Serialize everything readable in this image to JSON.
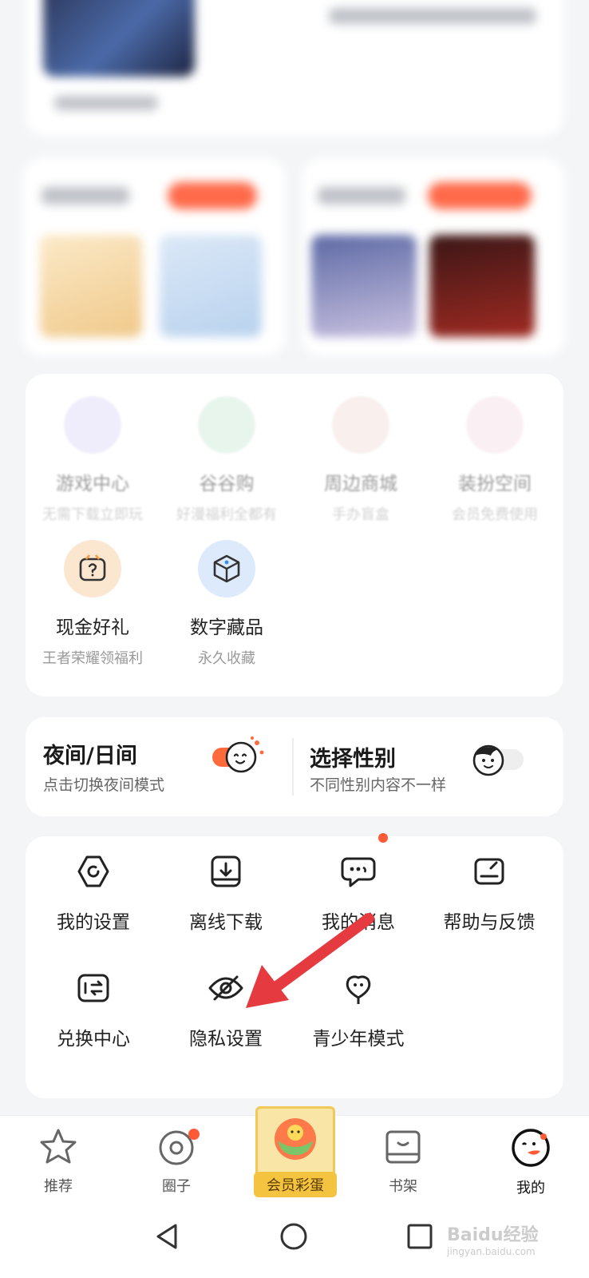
{
  "features": [
    {
      "title": "游戏中心",
      "sub": "无需下载立即玩",
      "icon": "game-icon",
      "color": "#d9d6f6",
      "faded": true
    },
    {
      "title": "谷谷购",
      "sub": "好漫福利全都有",
      "icon": "gift-icon",
      "color": "#cdebd9",
      "faded": true
    },
    {
      "title": "周边商城",
      "sub": "手办盲盒",
      "icon": "shop-icon",
      "color": "#f2dcd6",
      "faded": true
    },
    {
      "title": "装扮空间",
      "sub": "会员免费使用",
      "icon": "dress-icon",
      "color": "#f6dde3",
      "faded": true
    },
    {
      "title": "现金好礼",
      "sub": "王者荣耀领福利",
      "icon": "mystery-box-icon",
      "color": "#fbe3cc",
      "faded": false
    },
    {
      "title": "数字藏品",
      "sub": "永久收藏",
      "icon": "cube-icon",
      "color": "#dceafb",
      "faded": false
    }
  ],
  "toggles": {
    "night": {
      "title": "夜间/日间",
      "sub": "点击切换夜间模式",
      "accent": "#ff6a3d"
    },
    "gender": {
      "title": "选择性别",
      "sub": "不同性别内容不一样"
    }
  },
  "settings": [
    {
      "label": "我的设置",
      "icon": "settings-icon"
    },
    {
      "label": "离线下载",
      "icon": "download-icon"
    },
    {
      "label": "我的消息",
      "icon": "message-icon",
      "badge": true
    },
    {
      "label": "帮助与反馈",
      "icon": "feedback-icon"
    },
    {
      "label": "兑换中心",
      "icon": "exchange-icon"
    },
    {
      "label": "隐私设置",
      "icon": "privacy-icon"
    },
    {
      "label": "青少年模式",
      "icon": "youth-mode-icon"
    }
  ],
  "tabs": [
    {
      "label": "推荐",
      "icon": "star-icon"
    },
    {
      "label": "圈子",
      "icon": "circle-icon",
      "badge": true
    },
    {
      "label": "会员彩蛋",
      "icon": "easter-egg-icon"
    },
    {
      "label": "书架",
      "icon": "bookshelf-icon"
    },
    {
      "label": "我的",
      "icon": "profile-icon",
      "active": true
    }
  ],
  "watermark": {
    "text": "Baidu经验",
    "sub": "jingyan.baidu.com"
  },
  "colors": {
    "accent": "#ff5a36",
    "arrow": "#e53a3f"
  }
}
